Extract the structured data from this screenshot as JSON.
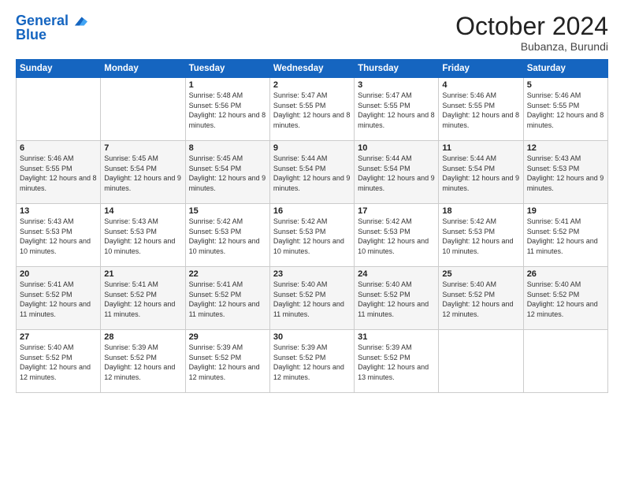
{
  "header": {
    "logo_line1": "General",
    "logo_line2": "Blue",
    "month_title": "October 2024",
    "subtitle": "Bubanza, Burundi"
  },
  "weekdays": [
    "Sunday",
    "Monday",
    "Tuesday",
    "Wednesday",
    "Thursday",
    "Friday",
    "Saturday"
  ],
  "weeks": [
    [
      {
        "day": "",
        "sunrise": "",
        "sunset": "",
        "daylight": ""
      },
      {
        "day": "",
        "sunrise": "",
        "sunset": "",
        "daylight": ""
      },
      {
        "day": "1",
        "sunrise": "Sunrise: 5:48 AM",
        "sunset": "Sunset: 5:56 PM",
        "daylight": "Daylight: 12 hours and 8 minutes."
      },
      {
        "day": "2",
        "sunrise": "Sunrise: 5:47 AM",
        "sunset": "Sunset: 5:55 PM",
        "daylight": "Daylight: 12 hours and 8 minutes."
      },
      {
        "day": "3",
        "sunrise": "Sunrise: 5:47 AM",
        "sunset": "Sunset: 5:55 PM",
        "daylight": "Daylight: 12 hours and 8 minutes."
      },
      {
        "day": "4",
        "sunrise": "Sunrise: 5:46 AM",
        "sunset": "Sunset: 5:55 PM",
        "daylight": "Daylight: 12 hours and 8 minutes."
      },
      {
        "day": "5",
        "sunrise": "Sunrise: 5:46 AM",
        "sunset": "Sunset: 5:55 PM",
        "daylight": "Daylight: 12 hours and 8 minutes."
      }
    ],
    [
      {
        "day": "6",
        "sunrise": "Sunrise: 5:46 AM",
        "sunset": "Sunset: 5:55 PM",
        "daylight": "Daylight: 12 hours and 8 minutes."
      },
      {
        "day": "7",
        "sunrise": "Sunrise: 5:45 AM",
        "sunset": "Sunset: 5:54 PM",
        "daylight": "Daylight: 12 hours and 9 minutes."
      },
      {
        "day": "8",
        "sunrise": "Sunrise: 5:45 AM",
        "sunset": "Sunset: 5:54 PM",
        "daylight": "Daylight: 12 hours and 9 minutes."
      },
      {
        "day": "9",
        "sunrise": "Sunrise: 5:44 AM",
        "sunset": "Sunset: 5:54 PM",
        "daylight": "Daylight: 12 hours and 9 minutes."
      },
      {
        "day": "10",
        "sunrise": "Sunrise: 5:44 AM",
        "sunset": "Sunset: 5:54 PM",
        "daylight": "Daylight: 12 hours and 9 minutes."
      },
      {
        "day": "11",
        "sunrise": "Sunrise: 5:44 AM",
        "sunset": "Sunset: 5:54 PM",
        "daylight": "Daylight: 12 hours and 9 minutes."
      },
      {
        "day": "12",
        "sunrise": "Sunrise: 5:43 AM",
        "sunset": "Sunset: 5:53 PM",
        "daylight": "Daylight: 12 hours and 9 minutes."
      }
    ],
    [
      {
        "day": "13",
        "sunrise": "Sunrise: 5:43 AM",
        "sunset": "Sunset: 5:53 PM",
        "daylight": "Daylight: 12 hours and 10 minutes."
      },
      {
        "day": "14",
        "sunrise": "Sunrise: 5:43 AM",
        "sunset": "Sunset: 5:53 PM",
        "daylight": "Daylight: 12 hours and 10 minutes."
      },
      {
        "day": "15",
        "sunrise": "Sunrise: 5:42 AM",
        "sunset": "Sunset: 5:53 PM",
        "daylight": "Daylight: 12 hours and 10 minutes."
      },
      {
        "day": "16",
        "sunrise": "Sunrise: 5:42 AM",
        "sunset": "Sunset: 5:53 PM",
        "daylight": "Daylight: 12 hours and 10 minutes."
      },
      {
        "day": "17",
        "sunrise": "Sunrise: 5:42 AM",
        "sunset": "Sunset: 5:53 PM",
        "daylight": "Daylight: 12 hours and 10 minutes."
      },
      {
        "day": "18",
        "sunrise": "Sunrise: 5:42 AM",
        "sunset": "Sunset: 5:53 PM",
        "daylight": "Daylight: 12 hours and 10 minutes."
      },
      {
        "day": "19",
        "sunrise": "Sunrise: 5:41 AM",
        "sunset": "Sunset: 5:52 PM",
        "daylight": "Daylight: 12 hours and 11 minutes."
      }
    ],
    [
      {
        "day": "20",
        "sunrise": "Sunrise: 5:41 AM",
        "sunset": "Sunset: 5:52 PM",
        "daylight": "Daylight: 12 hours and 11 minutes."
      },
      {
        "day": "21",
        "sunrise": "Sunrise: 5:41 AM",
        "sunset": "Sunset: 5:52 PM",
        "daylight": "Daylight: 12 hours and 11 minutes."
      },
      {
        "day": "22",
        "sunrise": "Sunrise: 5:41 AM",
        "sunset": "Sunset: 5:52 PM",
        "daylight": "Daylight: 12 hours and 11 minutes."
      },
      {
        "day": "23",
        "sunrise": "Sunrise: 5:40 AM",
        "sunset": "Sunset: 5:52 PM",
        "daylight": "Daylight: 12 hours and 11 minutes."
      },
      {
        "day": "24",
        "sunrise": "Sunrise: 5:40 AM",
        "sunset": "Sunset: 5:52 PM",
        "daylight": "Daylight: 12 hours and 11 minutes."
      },
      {
        "day": "25",
        "sunrise": "Sunrise: 5:40 AM",
        "sunset": "Sunset: 5:52 PM",
        "daylight": "Daylight: 12 hours and 12 minutes."
      },
      {
        "day": "26",
        "sunrise": "Sunrise: 5:40 AM",
        "sunset": "Sunset: 5:52 PM",
        "daylight": "Daylight: 12 hours and 12 minutes."
      }
    ],
    [
      {
        "day": "27",
        "sunrise": "Sunrise: 5:40 AM",
        "sunset": "Sunset: 5:52 PM",
        "daylight": "Daylight: 12 hours and 12 minutes."
      },
      {
        "day": "28",
        "sunrise": "Sunrise: 5:39 AM",
        "sunset": "Sunset: 5:52 PM",
        "daylight": "Daylight: 12 hours and 12 minutes."
      },
      {
        "day": "29",
        "sunrise": "Sunrise: 5:39 AM",
        "sunset": "Sunset: 5:52 PM",
        "daylight": "Daylight: 12 hours and 12 minutes."
      },
      {
        "day": "30",
        "sunrise": "Sunrise: 5:39 AM",
        "sunset": "Sunset: 5:52 PM",
        "daylight": "Daylight: 12 hours and 12 minutes."
      },
      {
        "day": "31",
        "sunrise": "Sunrise: 5:39 AM",
        "sunset": "Sunset: 5:52 PM",
        "daylight": "Daylight: 12 hours and 13 minutes."
      },
      {
        "day": "",
        "sunrise": "",
        "sunset": "",
        "daylight": ""
      },
      {
        "day": "",
        "sunrise": "",
        "sunset": "",
        "daylight": ""
      }
    ]
  ]
}
